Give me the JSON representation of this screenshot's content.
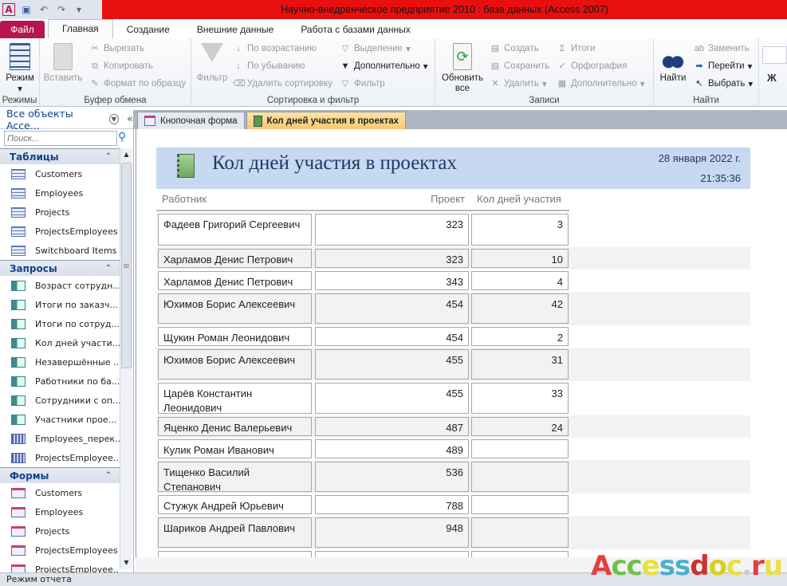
{
  "window": {
    "title": "Научно-внедренческое предприятие 2010 : база данных (Access 2007)"
  },
  "ribbon_tabs": [
    "Файл",
    "Главная",
    "Создание",
    "Внешние данные",
    "Работа с базами данных"
  ],
  "ribbon": {
    "groups": {
      "views": "Режимы",
      "clipboard": "Буфер обмена",
      "sort": "Сортировка и фильтр",
      "records": "Записи",
      "find": "Найти"
    },
    "view": "Режим",
    "paste": "Вставить",
    "cut": "Вырезать",
    "copy": "Копировать",
    "format_painter": "Формат по образцу",
    "filter": "Фильтр",
    "asc": "По возрастанию",
    "desc": "По убыванию",
    "remove_sort": "Удалить сортировку",
    "selection": "Выделение",
    "advanced": "Дополнительно",
    "toggle_filter": "Фильтр",
    "refresh": "Обновить все",
    "new": "Создать",
    "save": "Сохранить",
    "delete": "Удалить",
    "totals": "Итоги",
    "spelling": "Орфография",
    "more": "Дополнительно",
    "find": "Найти",
    "replace": "Заменить",
    "goto": "Перейти",
    "select": "Выбрать",
    "bold": "Ж"
  },
  "nav": {
    "header": "Все объекты Acce...",
    "search_placeholder": "Поиск...",
    "sections": [
      {
        "title": "Таблицы",
        "icon": "table",
        "items": [
          "Customers",
          "Employees",
          "Projects",
          "ProjectsEmployees",
          "Switchboard Items"
        ]
      },
      {
        "title": "Запросы",
        "icon": "query",
        "items": [
          "Возраст сотрудн...",
          "Итоги по заказч...",
          "Итоги по сотруд...",
          "Кол дней участи...",
          "Незавершённые ...",
          "Работники по ба...",
          "Сотрудники с оп...",
          "Участники прое...",
          "Employees_перек...",
          "ProjectsEmployee..."
        ]
      },
      {
        "title": "Формы",
        "icon": "form",
        "items": [
          "Customers",
          "Employees",
          "Projects",
          "ProjectsEmployees",
          "ProjectsEmployee..."
        ]
      }
    ]
  },
  "doc_tabs": [
    {
      "label": "Кнопочная форма",
      "active": false
    },
    {
      "label": "Кол дней участия в проектах",
      "active": true
    }
  ],
  "report": {
    "title": "Кол дней участия в проектах",
    "date": "28 января 2022 г.",
    "time": "21:35:36",
    "columns": [
      "Работник",
      "Проект",
      "Кол дней участия"
    ],
    "rows": [
      [
        "Фадеев Григорий Сергеевич",
        "323",
        "3"
      ],
      [
        "Харламов Денис Петрович",
        "323",
        "10"
      ],
      [
        "Харламов Денис Петрович",
        "343",
        "4"
      ],
      [
        "Юхимов Борис Алексеевич",
        "454",
        "42"
      ],
      [
        "Щукин Роман Леонидович",
        "454",
        "2"
      ],
      [
        "Юхимов Борис Алексеевич",
        "455",
        "31"
      ],
      [
        "Царёв Константин Леонидович",
        "455",
        "33"
      ],
      [
        "Яценко Денис Валерьевич",
        "487",
        "24"
      ],
      [
        "Кулик Роман Иванович",
        "489",
        ""
      ],
      [
        "Тищенко Василий Степанович",
        "536",
        ""
      ],
      [
        "Стужук Андрей Юрьевич",
        "788",
        ""
      ],
      [
        "Шариков Андрей Павлович",
        "948",
        ""
      ]
    ]
  },
  "status": "Режим отчета",
  "watermark": "Accessdoc.ru",
  "colors": {
    "title_bar": "#e8100f",
    "file_tab": "#b5164f",
    "report_header": "#c6d9f0",
    "active_tab": "#fbc770"
  }
}
